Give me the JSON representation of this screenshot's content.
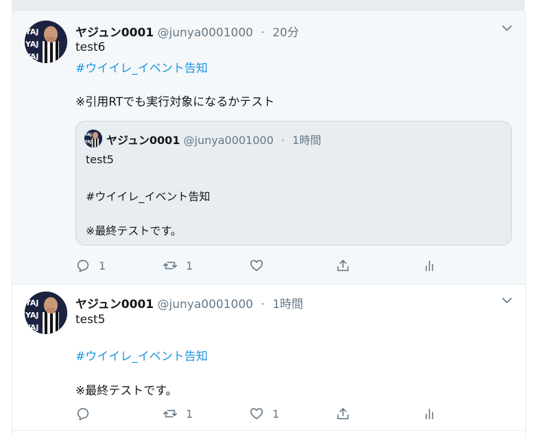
{
  "tweets": [
    {
      "name": "ヤジュン0001",
      "handle": "@junya0001000",
      "separator": "·",
      "time": "20分",
      "text_1": "test6",
      "hashtag": "#ウイイレ_イベント告知",
      "text_2": "※引用RTでも実行対象になるかテスト",
      "quote": {
        "name": "ヤジュン0001",
        "handle": "@junya0001000",
        "separator": "·",
        "time": "1時間",
        "text_1": "test5",
        "text_2": "#ウイイレ_イベント告知",
        "text_3": "※最終テストです。"
      },
      "actions": {
        "reply_icon": "reply-icon",
        "reply_count": "1",
        "retweet_icon": "retweet-icon",
        "retweet_count": "1",
        "like_icon": "heart-icon",
        "like_count": "",
        "share_icon": "share-icon",
        "analytics_icon": "analytics-icon"
      }
    },
    {
      "name": "ヤジュン0001",
      "handle": "@junya0001000",
      "separator": "·",
      "time": "1時間",
      "text_1": "test5",
      "hashtag": "#ウイイレ_イベント告知",
      "text_2": "※最終テストです。",
      "actions": {
        "reply_icon": "reply-icon",
        "reply_count": "",
        "retweet_icon": "retweet-icon",
        "retweet_count": "1",
        "like_icon": "heart-icon",
        "like_count": "1",
        "share_icon": "share-icon",
        "analytics_icon": "analytics-icon"
      }
    }
  ],
  "colors": {
    "link": "#1b95e0",
    "muted": "#657786",
    "text": "#14171a",
    "highlight_bg": "#f5f8fa"
  }
}
